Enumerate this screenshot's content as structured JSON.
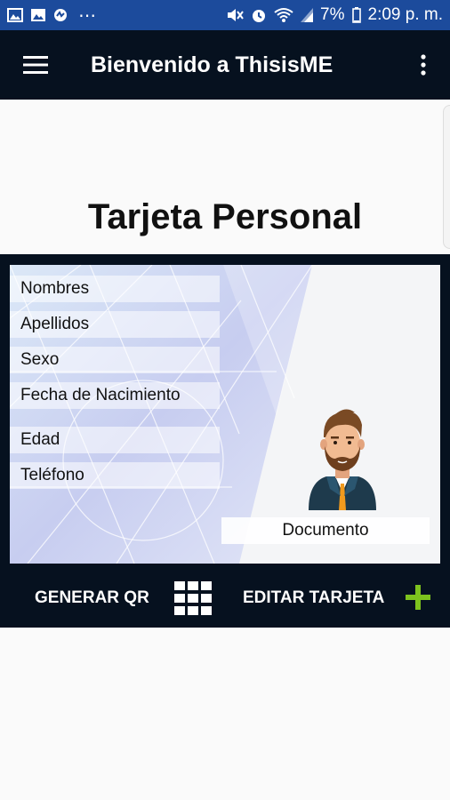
{
  "status_bar": {
    "battery": "7%",
    "time": "2:09 p. m.",
    "more": "⋯"
  },
  "app_bar": {
    "title": "Bienvenido a ThisisME",
    "menu_icon": "hamburger-menu-icon",
    "overflow_icon": "more-vert-icon"
  },
  "page": {
    "title": "Tarjeta Personal"
  },
  "card": {
    "fields": [
      {
        "label": "Nombres"
      },
      {
        "label": "Apellidos"
      },
      {
        "label": "Sexo"
      },
      {
        "label": "Fecha de Nacimiento"
      },
      {
        "label": "Edad"
      },
      {
        "label": "Teléfono"
      }
    ],
    "document_label": "Documento",
    "avatar_icon": "person-avatar-icon"
  },
  "actions": {
    "generate_qr_label": "GENERAR QR",
    "edit_card_label": "EDITAR TARJETA",
    "qr_icon": "grid-icon",
    "plus_icon": "plus-icon"
  },
  "colors": {
    "status_bar": "#1c4b9c",
    "app_bar": "#06111f",
    "accent_plus": "#7dc21e",
    "background": "#fafafa"
  }
}
